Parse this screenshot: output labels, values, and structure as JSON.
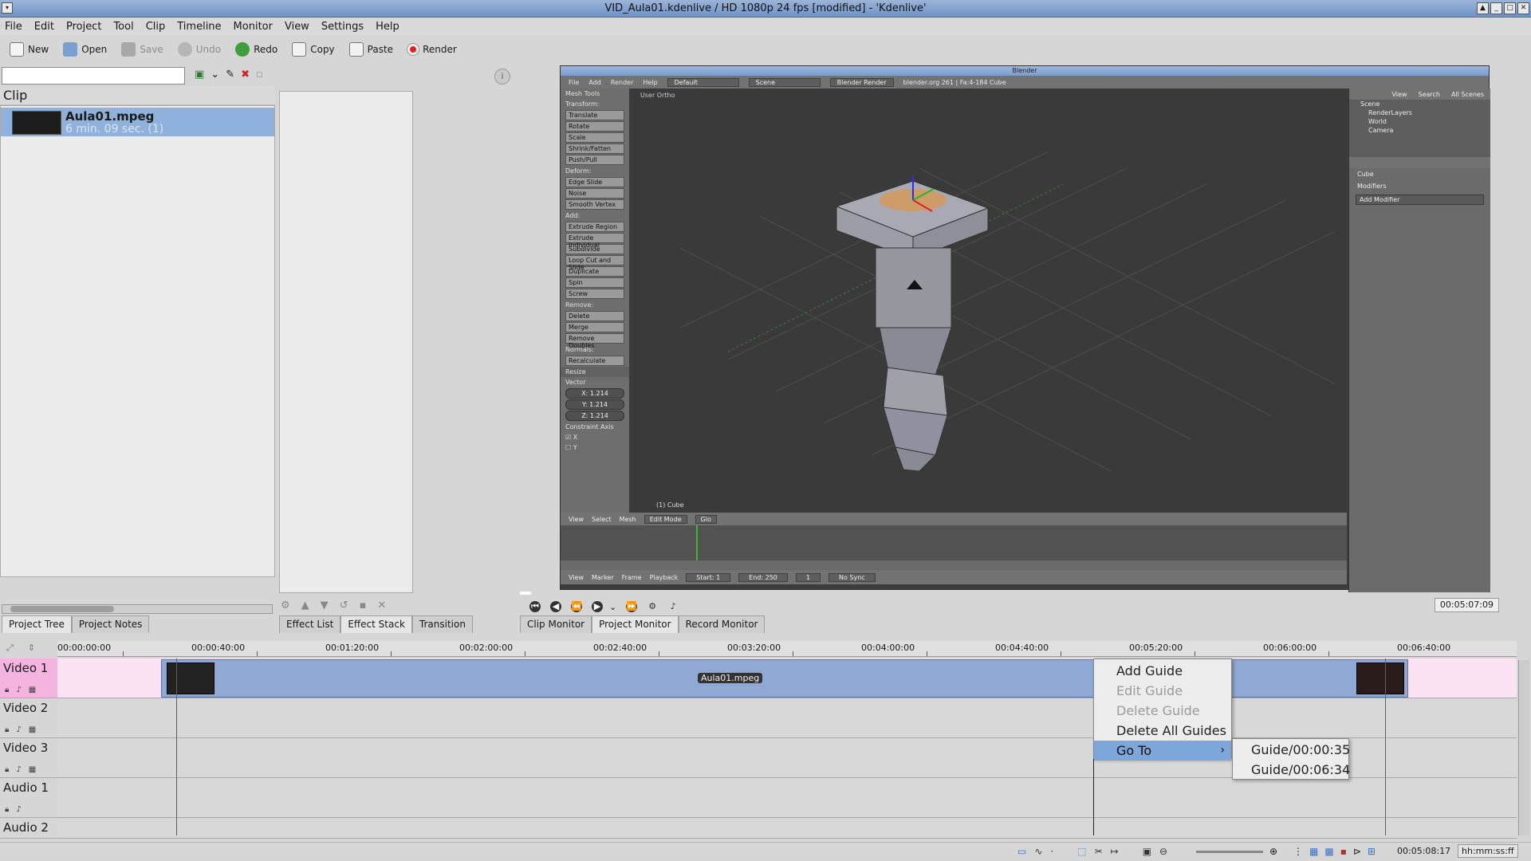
{
  "window": {
    "title": "VID_Aula01.kdenlive / HD 1080p 24 fps [modified] - 'Kdenlive'"
  },
  "menubar": [
    "File",
    "Edit",
    "Project",
    "Tool",
    "Clip",
    "Timeline",
    "Monitor",
    "View",
    "Settings",
    "Help"
  ],
  "toolbar": {
    "new": "New",
    "open": "Open",
    "save": "Save",
    "undo": "Undo",
    "redo": "Redo",
    "copy": "Copy",
    "paste": "Paste",
    "render": "Render"
  },
  "project_tree": {
    "header": "Clip",
    "clip": {
      "name": "Aula01.mpeg",
      "duration": "6 min. 09 sec. (1)"
    }
  },
  "left_tabs": [
    "Project Tree",
    "Project Notes"
  ],
  "effect_tabs": [
    "Effect List",
    "Effect Stack",
    "Transition"
  ],
  "monitor_tabs": [
    "Clip Monitor",
    "Project Monitor",
    "Record Monitor"
  ],
  "monitor": {
    "timecode": "00:05:07:09"
  },
  "blender": {
    "title": "Blender",
    "header": {
      "menus": [
        "File",
        "Add",
        "Render",
        "Help"
      ],
      "layout": "Default",
      "scene": "Scene",
      "engine": "Blender Render",
      "info": "blender.org 261 | Fa:4-184  Cube"
    },
    "toolshelf": {
      "title": "Mesh Tools",
      "sections": [
        {
          "name": "Transform:",
          "items": [
            "Translate",
            "Rotate",
            "Scale",
            "Shrink/Fatten",
            "Push/Pull"
          ]
        },
        {
          "name": "Deform:",
          "items": [
            "Edge Slide",
            "Noise",
            "Smooth Vertex"
          ]
        },
        {
          "name": "Add:",
          "items": [
            "Extrude Region",
            "Extrude Individual",
            "Subdivide",
            "Loop Cut and Slide",
            "Duplicate",
            "Spin",
            "Screw"
          ]
        },
        {
          "name": "Remove:",
          "items": [
            "Delete",
            "Merge",
            "Remove Doubles"
          ]
        },
        {
          "name": "Normals:",
          "items": [
            "Recalculate"
          ]
        }
      ],
      "resize": "Resize",
      "vector_label": "Vector",
      "vector": [
        "X: 1.214",
        "Y: 1.214",
        "Z: 1.214"
      ],
      "constraint_label": "Constraint Axis",
      "constraint": [
        "X",
        "Y"
      ]
    },
    "viewport": {
      "view_label": "User Ortho",
      "object_label": "(1) Cube"
    },
    "vp_header": {
      "menus": [
        "View",
        "Select",
        "Mesh"
      ],
      "mode": "Edit Mode",
      "pivot": "Glo"
    },
    "timeline_header": {
      "menus": [
        "View",
        "Marker",
        "Frame",
        "Playback"
      ],
      "start": "Start: 1",
      "end": "End: 250",
      "frame": "1",
      "sync": "No Sync"
    },
    "outliner": {
      "head": [
        "View",
        "Search",
        "All Scenes"
      ],
      "rows": [
        "Scene",
        "RenderLayers",
        "World",
        "Camera"
      ]
    },
    "properties": {
      "object": "Cube",
      "modifiers": "Modifiers",
      "add_modifier": "Add Modifier"
    }
  },
  "timeline": {
    "ruler": [
      "00:00:00:00",
      "00:00:40:00",
      "00:01:20:00",
      "00:02:00:00",
      "00:02:40:00",
      "00:03:20:00",
      "00:04:00:00",
      "00:04:40:00",
      "00:05:20:00",
      "00:06:00:00",
      "00:06:40:00"
    ],
    "tracks": [
      "Video 1",
      "Video 2",
      "Video 3",
      "Audio 1",
      "Audio 2"
    ],
    "clip_label": "Aula01.mpeg"
  },
  "context_menu": {
    "items": [
      "Add Guide",
      "Edit Guide",
      "Delete Guide",
      "Delete All Guides",
      "Go To"
    ],
    "submenu": [
      "Guide/00:00:35",
      "Guide/00:06:34"
    ]
  },
  "statusbar": {
    "time": "00:05:08:17",
    "format": "hh:mm:ss:ff"
  }
}
